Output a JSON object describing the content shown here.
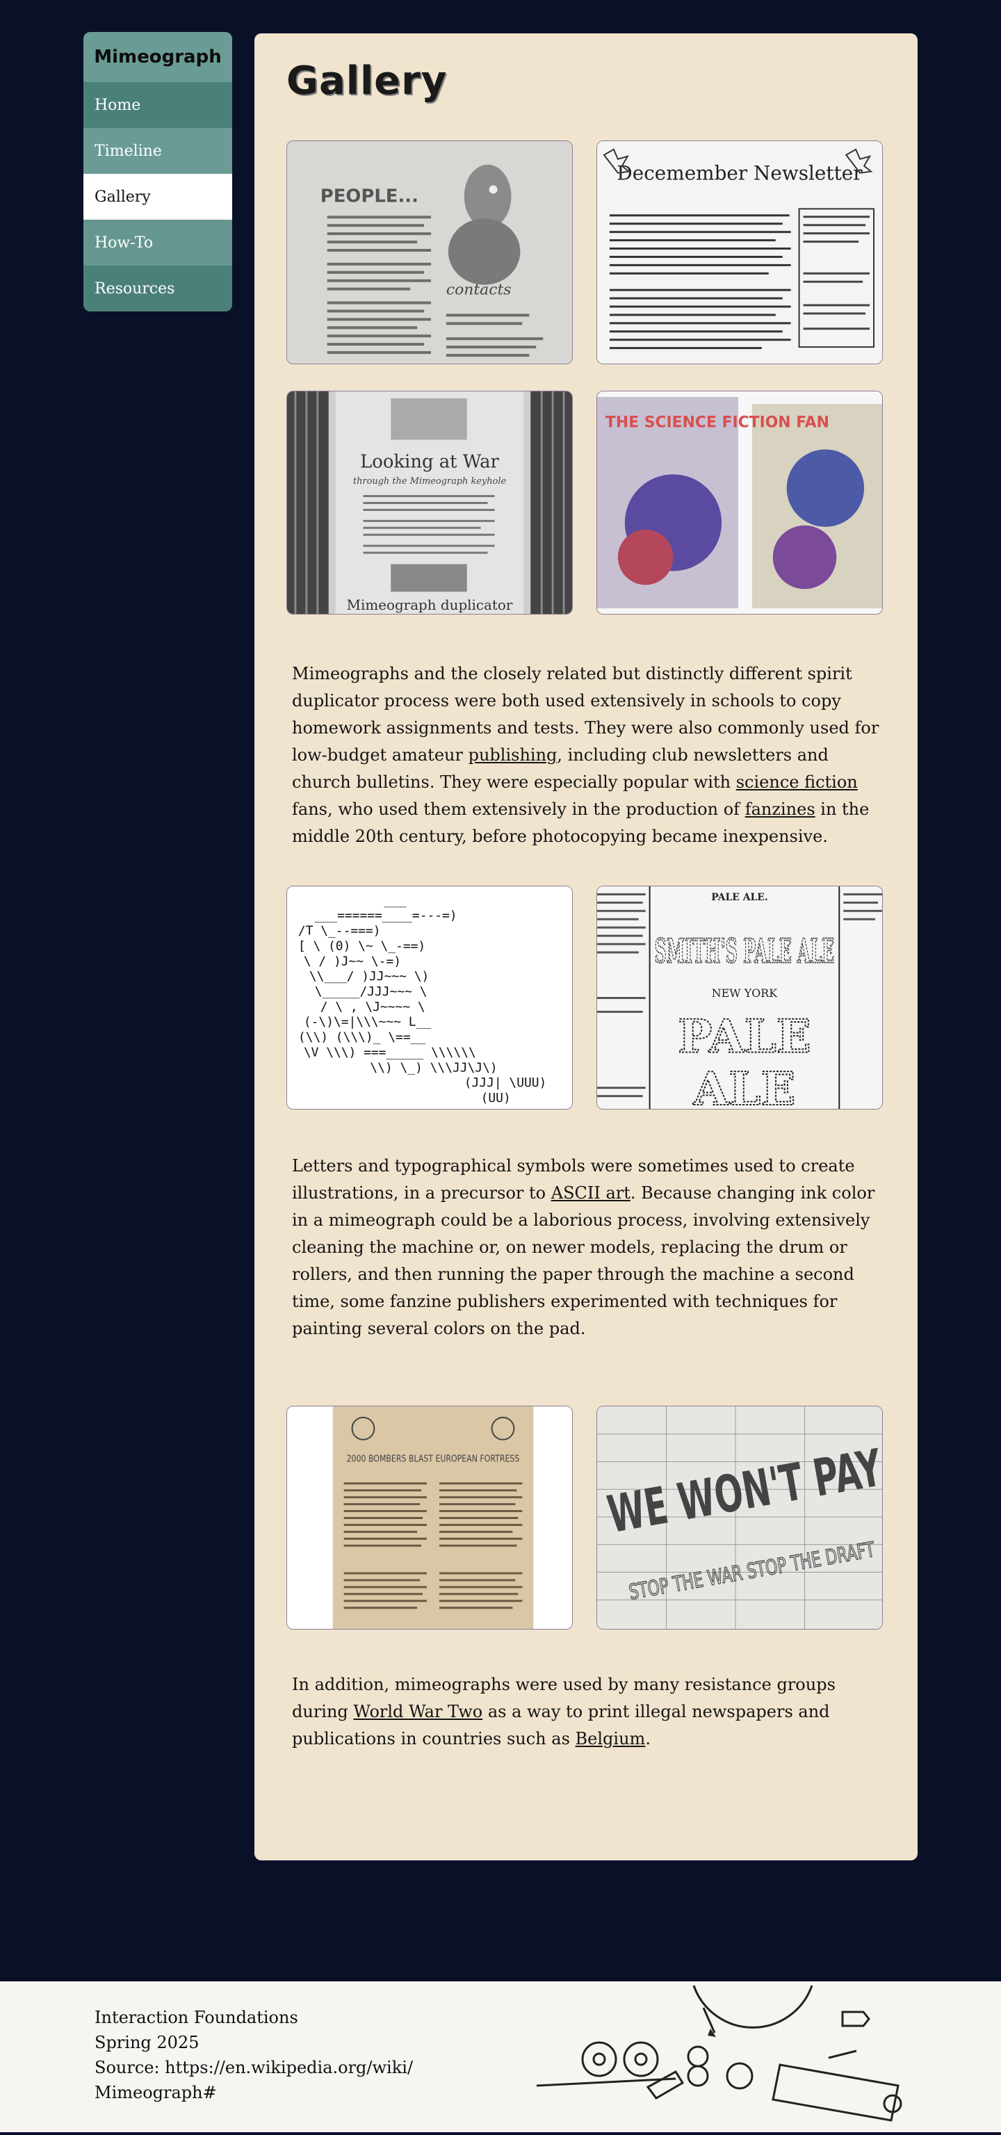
{
  "sidebar": {
    "brand": "Mimeograph",
    "items": [
      {
        "label": "Home"
      },
      {
        "label": "Timeline"
      },
      {
        "label": "Gallery"
      },
      {
        "label": "How-To"
      },
      {
        "label": "Resources"
      }
    ],
    "active": "Gallery"
  },
  "main": {
    "title": "Gallery",
    "gallery_row1": [
      {
        "icon": "people-contacts-zine-image",
        "caption": "PEOPLE..."
      },
      {
        "icon": "decemember-newsletter-image",
        "caption": "Decemember Newsletter"
      }
    ],
    "gallery_row2": [
      {
        "icon": "looking-at-war-ad-image",
        "caption": "Looking at War",
        "subcaption": "through the Mimeograph keyhole",
        "footer": "Mimeograph duplicator"
      },
      {
        "icon": "science-fiction-fan-covers-image",
        "caption": "THE SCIENCE FICTION FAN"
      }
    ],
    "paragraph1": {
      "t1": "Mimeographs and the closely related but distinctly different spirit duplicator process were both used extensively in schools to copy homework assignments and tests. They were also commonly used for low-budget amateur ",
      "link1": "publishing",
      "t2": ", including club newsletters and church bulletins. They were especially popular with ",
      "link2": "science fiction",
      "t3": " fans, who used them extensively in the production of ",
      "link3": "fanzines",
      "t4": " in the middle 20th century, before photocopying became inexpensive."
    },
    "gallery_row3": [
      {
        "icon": "typewriter-art-image"
      },
      {
        "icon": "smiths-pale-ale-image",
        "caption": "SMITH'S PALE ALE",
        "header": "PALE ALE.",
        "subheader": "NEW YORK"
      }
    ],
    "paragraph2": {
      "t1": "Letters and typographical symbols were sometimes used to create illustrations, in a precursor to ",
      "link1": "ASCII art",
      "t2": ". Because changing ink color in a mimeograph could be a laborious process, involving extensively cleaning the machine or, on newer models, replacing the drum or rollers, and then running the paper through the machine a second time, some fanzine publishers experimented with techniques for painting several colors on the pad."
    },
    "gallery_row4": [
      {
        "icon": "resistance-newspaper-image",
        "caption": "2000 BOMBERS BLAST EUROPEAN FORTRESS"
      },
      {
        "icon": "we-wont-pay-poster-image",
        "caption": "WE WON'T PAY",
        "subcaption": "STOP THE WAR STOP THE DRAFT"
      }
    ],
    "paragraph3": {
      "t1": "In addition, mimeographs were used by many resistance groups during ",
      "link1": "World War Two",
      "t2": " as a way to print illegal newspapers and publications in countries such as ",
      "link2": "Belgium",
      "t3": "."
    }
  },
  "footer": {
    "line1": "Interaction Foundations",
    "line2": "Spring 2025",
    "line3": "Source: https://en.wikipedia.org/wiki/",
    "line4": "Mimeograph#",
    "art_icon": "mimeograph-diagram-icon"
  },
  "colors": {
    "background": "#0b1029",
    "panel": "#f1e4ce",
    "sidebar": "#4a8079",
    "sidebar_light": "#6a9c95",
    "active": "#ffffff"
  }
}
